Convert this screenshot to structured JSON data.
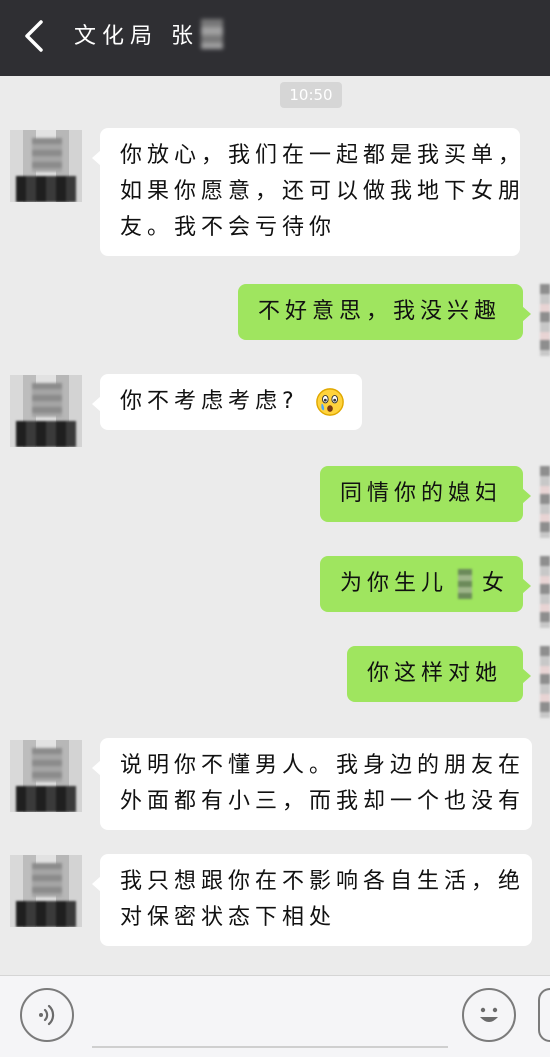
{
  "header": {
    "title": "文化局 张"
  },
  "timestamp": "10:50",
  "messages": [
    {
      "side": "left",
      "lines": [
        "你放心，我们在一起都是我买单，",
        "如果你愿意，还可以做我地下女朋",
        "友。我不会亏待你"
      ]
    },
    {
      "side": "right",
      "text": "不好意思，我没兴趣"
    },
    {
      "side": "left",
      "text": "你不考虑考虑?"
    },
    {
      "side": "right",
      "text": "同情你的媳妇"
    },
    {
      "side": "right",
      "text_before": "为你生儿",
      "text_after": "女"
    },
    {
      "side": "right",
      "text": "你这样对她"
    },
    {
      "side": "left",
      "lines": [
        "说明你不懂男人。我身边的朋友在",
        "外面都有小三，而我却一个也没有"
      ]
    },
    {
      "side": "left",
      "lines": [
        "我只想跟你在不影响各自生活，绝",
        "对保密状态下相处"
      ]
    }
  ],
  "icons": {
    "back": "back-chevron-icon",
    "voice": "voice-icon",
    "emoji": "emoji-smiley-icon",
    "crying_emoji": "crying-face-emoji"
  },
  "colors": {
    "topbar": "#2f2f33",
    "background": "#ebebeb",
    "incoming_bubble": "#ffffff",
    "outgoing_bubble": "#9fe55f"
  }
}
